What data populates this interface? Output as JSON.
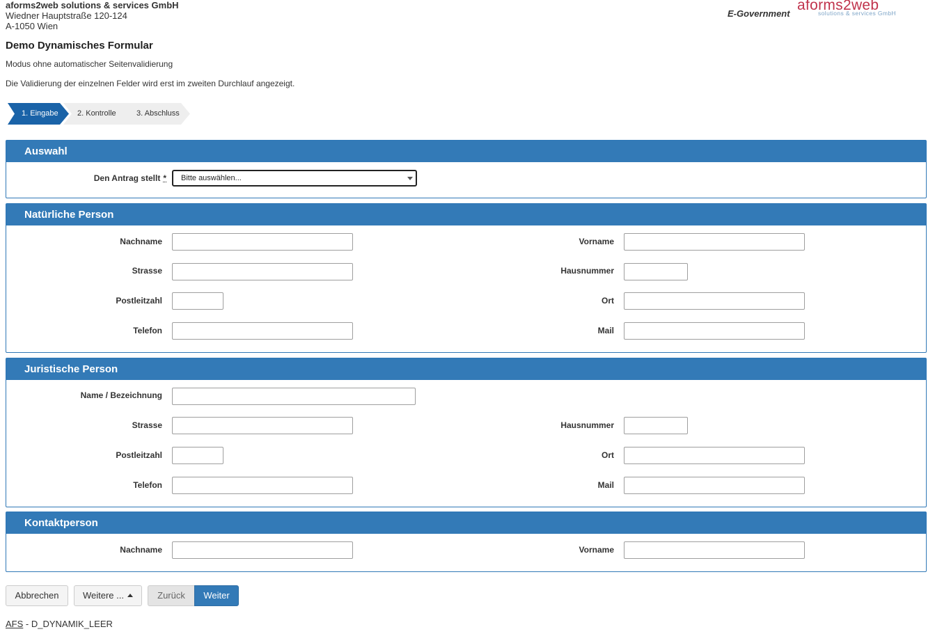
{
  "header": {
    "company": "aforms2web solutions & services GmbH",
    "street": "Wiedner Hauptstraße 120-124",
    "city": "A-1050 Wien",
    "egov": "E-Government",
    "logo_main": "aforms2web",
    "logo_sub": "solutions & services GmbH"
  },
  "page": {
    "title": "Demo Dynamisches Formular",
    "subtitle": "Modus ohne automatischer Seitenvalidierung",
    "info": "Die Validierung der einzelnen Felder wird erst im zweiten Durchlauf angezeigt."
  },
  "steps": [
    "1. Eingabe",
    "2. Kontrolle",
    "3. Abschluss"
  ],
  "auswahl": {
    "heading": "Auswahl",
    "label": "Den Antrag stellt",
    "required_mark": "*",
    "select_value": "Bitte auswählen..."
  },
  "natuerlich": {
    "heading": "Natürliche Person",
    "nachname": "Nachname",
    "vorname": "Vorname",
    "strasse": "Strasse",
    "hausnummer": "Hausnummer",
    "plz": "Postleitzahl",
    "ort": "Ort",
    "telefon": "Telefon",
    "mail": "Mail"
  },
  "juristisch": {
    "heading": "Juristische Person",
    "name": "Name / Bezeichnung",
    "strasse": "Strasse",
    "hausnummer": "Hausnummer",
    "plz": "Postleitzahl",
    "ort": "Ort",
    "telefon": "Telefon",
    "mail": "Mail"
  },
  "kontakt": {
    "heading": "Kontaktperson",
    "nachname": "Nachname",
    "vorname": "Vorname"
  },
  "buttons": {
    "abbrechen": "Abbrechen",
    "weitere": "Weitere ...",
    "zurueck": "Zurück",
    "weiter": "Weiter"
  },
  "footer": {
    "afs": "AFS",
    "code": " - D_DYNAMIK_LEER"
  },
  "colors": {
    "panel_header": "#337ab7",
    "active_step": "#1a63a8",
    "logo": "#c0334c"
  },
  "icons": [
    "dropdown-arrow-icon",
    "caret-up-icon"
  ]
}
